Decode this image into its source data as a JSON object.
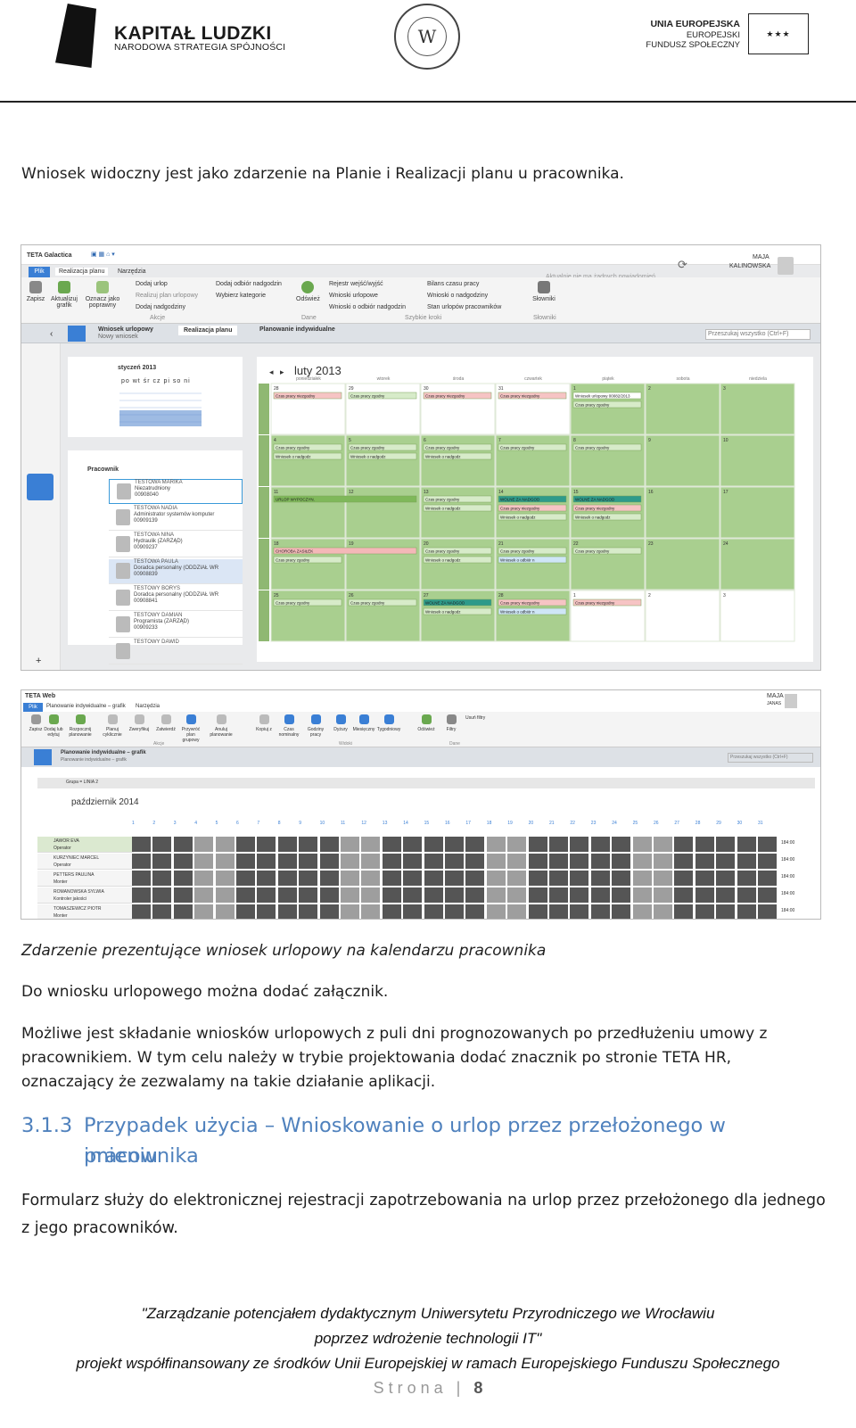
{
  "header": {
    "kl_title": "KAPITAŁ LUDZKI",
    "kl_subtitle": "NARODOWA STRATEGIA SPÓJNOŚCI",
    "eu_line1": "UNIA EUROPEJSKA",
    "eu_line2": "EUROPEJSKI",
    "eu_line3": "FUNDUSZ SPOŁECZNY"
  },
  "intro": "Wniosek widoczny jest jako zdarzenie na Planie i Realizacji planu u pracownika.",
  "screenshot1": {
    "app_title": "TETA Galactica",
    "tab_file": "Plik",
    "tab_realizacja": "Realizacja planu",
    "tab_narzedzia": "Narzędzia",
    "user_name": "MAJA",
    "user_surname": "KALINOWSKA",
    "notice": "Aktualnie nie ma żadnych powiadomień",
    "ribbon_buttons": [
      "Zapisz",
      "Aktualizuj grafik",
      "Oznacz jako poprawny",
      "Odśwież",
      "Słowniki"
    ],
    "ribbon_links": [
      "Dodaj urlop",
      "Realizuj plan urlopowy",
      "Dodaj nadgodziny",
      "Dodaj odbiór nadgodzin",
      "Wybierz kategorie",
      "Rejestr wejść/wyjść",
      "Wnioski urlopowe",
      "Wnioski o odbiór nadgodzin",
      "Bilans czasu pracy",
      "Wnioski o nadgodziny",
      "Stan urlopów pracowników"
    ],
    "group_labels": [
      "Akcje",
      "Dane",
      "Szybkie kroki",
      "Słowniki"
    ],
    "doc_tabs": [
      "Wniosek urlopowy",
      "Realizacja planu",
      "Planowanie indywidualne"
    ],
    "doc_tab_sub": "Nowy wniosek",
    "search_placeholder": "Przeszukaj wszystko (Ctrl+F)",
    "mini_cal_month": "styczeń 2013",
    "mini_cal_days": [
      "po",
      "wt",
      "śr",
      "cz",
      "pi",
      "so",
      "ni"
    ],
    "month_title": "luty 2013",
    "weekday_headers": [
      "poniedziałek",
      "wtorek",
      "środa",
      "czwartek",
      "piątek",
      "sobota",
      "niedziela"
    ],
    "employee_header": "Pracownik",
    "employees": [
      {
        "name": "TESTOWA MARIKA",
        "role": "Niezatrudniony",
        "id": "00908040"
      },
      {
        "name": "TESTOWA NADIA",
        "role": "Administrator systemów komputer",
        "id": "00909139"
      },
      {
        "name": "TESTOWA NINA",
        "role": "Hydraulik (ZARZĄD)",
        "id": "00909237"
      },
      {
        "name": "TESTOWA PAULA",
        "role": "Doradca personalny (ODDZIAŁ WR",
        "id": "00908839"
      },
      {
        "name": "TESTOWY BORYS",
        "role": "Doradca personalny (ODDZIAŁ WR",
        "id": "00908841"
      },
      {
        "name": "TESTOWY DAMIAN",
        "role": "Programista (ZARZĄD)",
        "id": "00909233"
      },
      {
        "name": "TESTOWY DAWID",
        "role": "",
        "id": ""
      }
    ],
    "event_labels": {
      "work": "Czas pracy zgodny",
      "neg": "Czas pracy niezgodny",
      "overtime": "Wniosek o nadgodz",
      "urlop": "URLOP WYPOCZYN.",
      "sick": "CHOROBA ZASIŁEK",
      "wolne": "WOLNE ZA NADGOD",
      "odbior": "Wniosek o odbiór n",
      "urlop_req": "Wniosek urlopowy 00082/2013"
    }
  },
  "screenshot2": {
    "app_title": "TETA Web",
    "tab_file": "Plik",
    "tab_plan": "Planowanie indywidualne – grafik",
    "tab_narzedzia": "Narzędzia",
    "user_name": "MAJA",
    "user_surname": "JANAS",
    "filter_label": "Usuń filtry",
    "ribbon_buttons": [
      "Zapisz",
      "Dodaj lub edytuj",
      "Rozpocznij planowanie",
      "Planuj cyklicznie",
      "Zweryfikuj",
      "Zatwierdź",
      "Przywróć plan grupowy",
      "Anuluj planowanie",
      "Kopiuj z",
      "Czas nominalny",
      "Godziny pracy",
      "Dyżury",
      "Miesięczny",
      "Tygodniowy",
      "Odśwież",
      "Filtry"
    ],
    "group_labels": [
      "Akcje",
      "Widoki",
      "Dane"
    ],
    "doc_tab": "Planowanie indywidualne – grafik",
    "doc_tab_sub": "Planowanie indywidualne – grafik",
    "search_placeholder": "Przeszukaj wszystko (Ctrl+F)",
    "group_filter": "Grupa = LINIA 2",
    "month_title": "październik 2014",
    "employees": [
      {
        "name": "JAWOR EVA",
        "role": "Operator"
      },
      {
        "name": "KURZYNIEC MARCEL",
        "role": "Operator"
      },
      {
        "name": "PETTERS PAULINA",
        "role": "Monter"
      },
      {
        "name": "ROMANOWSKA SYLWIA",
        "role": "Kontroler jakości"
      },
      {
        "name": "TOMASZEWICZ PIOTR",
        "role": "Monter"
      }
    ],
    "summary_value": "184:00"
  },
  "caption": "Zdarzenie prezentujące wniosek urlopowy na kalendarzu pracownika",
  "para1": "Do wniosku urlopowego można dodać załącznik.",
  "para2_line1": "Możliwe jest składanie wniosków urlopowych z puli dni prognozowanych po przedłużeniu umowy z",
  "para2_line2": "pracownikiem. W tym celu należy w trybie projektowania dodać znacznik po stronie TETA HR,",
  "para2_line3": "oznaczający że zezwalamy na takie działanie aplikacji.",
  "heading_num": "3.1.3",
  "heading_line1": "Przypadek użycia – Wnioskowanie o urlop przez przełożonego w imieniu",
  "heading_line2": "pracownika",
  "para3_line1": "Formularz służy do elektronicznej rejestracji zapotrzebowania na urlop przez przełożonego dla jednego",
  "para3_line2": "z jego pracowników.",
  "footer": {
    "line1": "\"Zarządzanie potencjałem dydaktycznym Uniwersytetu Przyrodniczego we Wrocławiu",
    "line2": "poprzez wdrożenie technologii IT\"",
    "line3": "projekt współfinansowany ze środków Unii Europejskiej w ramach Europejskiego Funduszu Społecznego",
    "page_label": "Strona",
    "page_sep": "|",
    "page_num": "8"
  }
}
